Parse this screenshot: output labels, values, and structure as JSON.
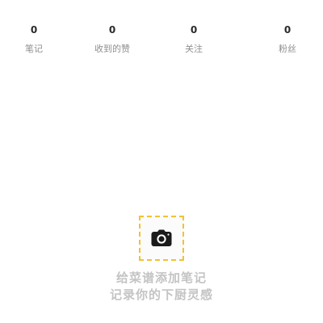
{
  "stats": [
    {
      "value": "0",
      "label": "笔记"
    },
    {
      "value": "0",
      "label": "收到的赞"
    },
    {
      "value": "0",
      "label": "关注"
    },
    {
      "value": "0",
      "label": "粉丝"
    }
  ],
  "add_note": {
    "icon": "camera-icon",
    "accent_color": "#f2c230",
    "hint_line1": "给菜谱添加笔记",
    "hint_line2": "记录你的下厨灵感"
  }
}
